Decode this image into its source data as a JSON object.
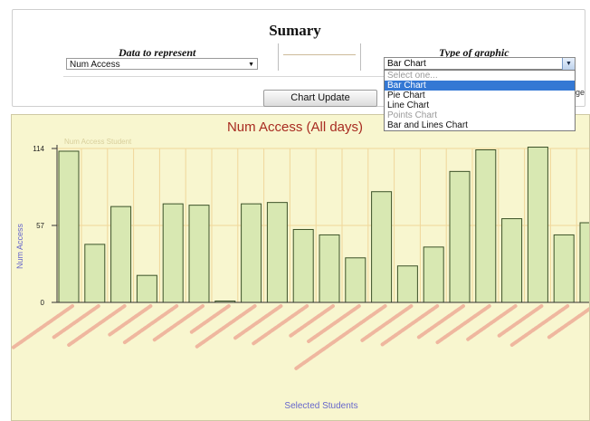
{
  "summary": {
    "title": "Sumary"
  },
  "controls": {
    "data_label": "Data to represent",
    "data_selected": "Num Access",
    "graphic_label": "Type of graphic",
    "graphic_selected": "Bar Chart",
    "graphic_options": [
      "Select one...",
      "Bar Chart",
      "Pie Chart",
      "Line Chart",
      "Points Chart",
      "Bar and Lines Chart"
    ],
    "update_button": "Chart Update",
    "clipped_text": "ge"
  },
  "chart_data": {
    "type": "bar",
    "title": "Num Access (All days)",
    "xlabel": "Selected Students",
    "ylabel": "Num Access",
    "legend": [
      "Num Access Student"
    ],
    "yticks": [
      0,
      57,
      114
    ],
    "ylim": [
      0,
      114
    ],
    "series": [
      {
        "name": "Num Access Student",
        "values": [
          112,
          43,
          71,
          20,
          73,
          72,
          1,
          73,
          74,
          54,
          50,
          33,
          82,
          27,
          41,
          97,
          113,
          62,
          115,
          50,
          59
        ]
      }
    ],
    "colors": {
      "bar_fill": "#d8e8b2",
      "bar_stroke": "#3c5228",
      "title": "#a82b21",
      "label": "#6666cc",
      "grid": "#f0d79a",
      "tick_label_blur": "#e88478"
    }
  }
}
